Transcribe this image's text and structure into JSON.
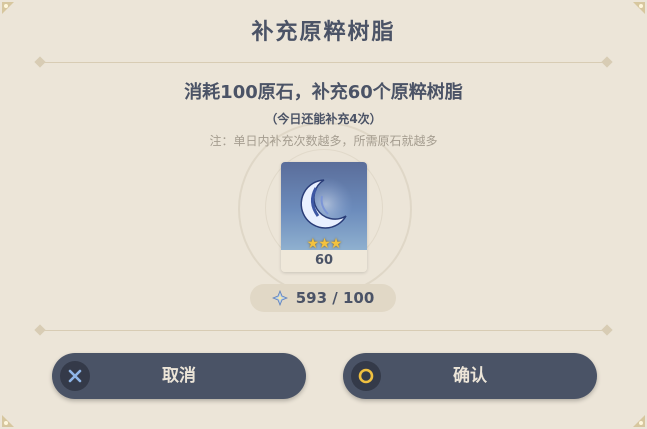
{
  "dialog": {
    "title": "补充原粹树脂",
    "main_text": "消耗100原石，补充60个原粹树脂",
    "sub_text": "（今日还能补充4次）",
    "note_text": "注：单日内补充次数越多，所需原石就越多"
  },
  "item": {
    "icon": "crescent-moon-resin-icon",
    "stars": "★★★",
    "rarity": 3,
    "count": "60"
  },
  "currency": {
    "icon": "primogem-icon",
    "amount": "593 / 100"
  },
  "buttons": {
    "cancel_label": "取消",
    "confirm_label": "确认"
  },
  "colors": {
    "background": "#ece5d8",
    "text": "#4b5366",
    "button": "#4a5366",
    "star": "#f4c23e",
    "confirm_ring": "#f0c040",
    "cancel_x": "#8fb6e8"
  }
}
